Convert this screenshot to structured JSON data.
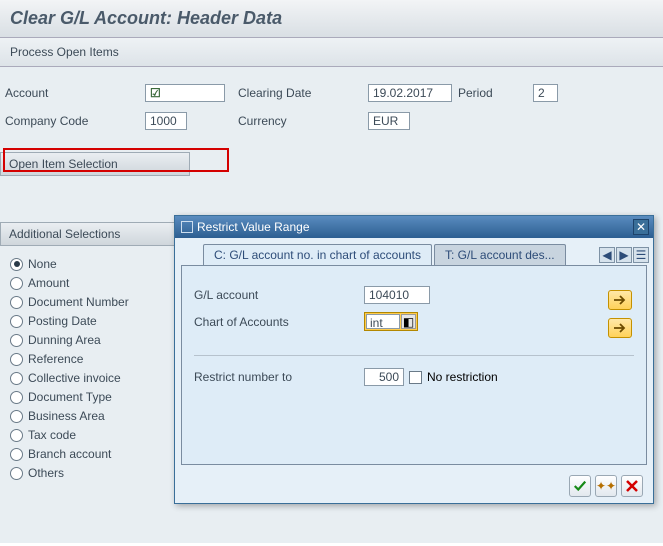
{
  "header": {
    "title": "Clear G/L Account: Header Data",
    "subtitle": "Process Open Items"
  },
  "form": {
    "account_label": "Account",
    "account_value": "",
    "company_code_label": "Company Code",
    "company_code_value": "1000",
    "clearing_date_label": "Clearing Date",
    "clearing_date_value": "19.02.2017",
    "period_label": "Period",
    "period_value": "2",
    "currency_label": "Currency",
    "currency_value": "EUR"
  },
  "panels": {
    "open_item_selection": "Open Item Selection",
    "additional_selections": "Additional Selections",
    "radios": {
      "none": "None",
      "amount": "Amount",
      "document_number": "Document Number",
      "posting_date": "Posting Date",
      "dunning_area": "Dunning Area",
      "reference": "Reference",
      "collective_invoice": "Collective invoice",
      "document_type": "Document Type",
      "business_area": "Business Area",
      "tax_code": "Tax code",
      "branch_account": "Branch account",
      "others": "Others"
    }
  },
  "popup": {
    "title": "Restrict Value Range",
    "tabs": {
      "active": "C: G/L account no. in chart of accounts",
      "inactive": "T: G/L account des..."
    },
    "gl_account_label": "G/L account",
    "gl_account_value": "104010",
    "chart_label": "Chart of Accounts",
    "chart_value": "int",
    "restrict_label": "Restrict number to",
    "restrict_value": "500",
    "no_restriction_label": "No restriction"
  }
}
